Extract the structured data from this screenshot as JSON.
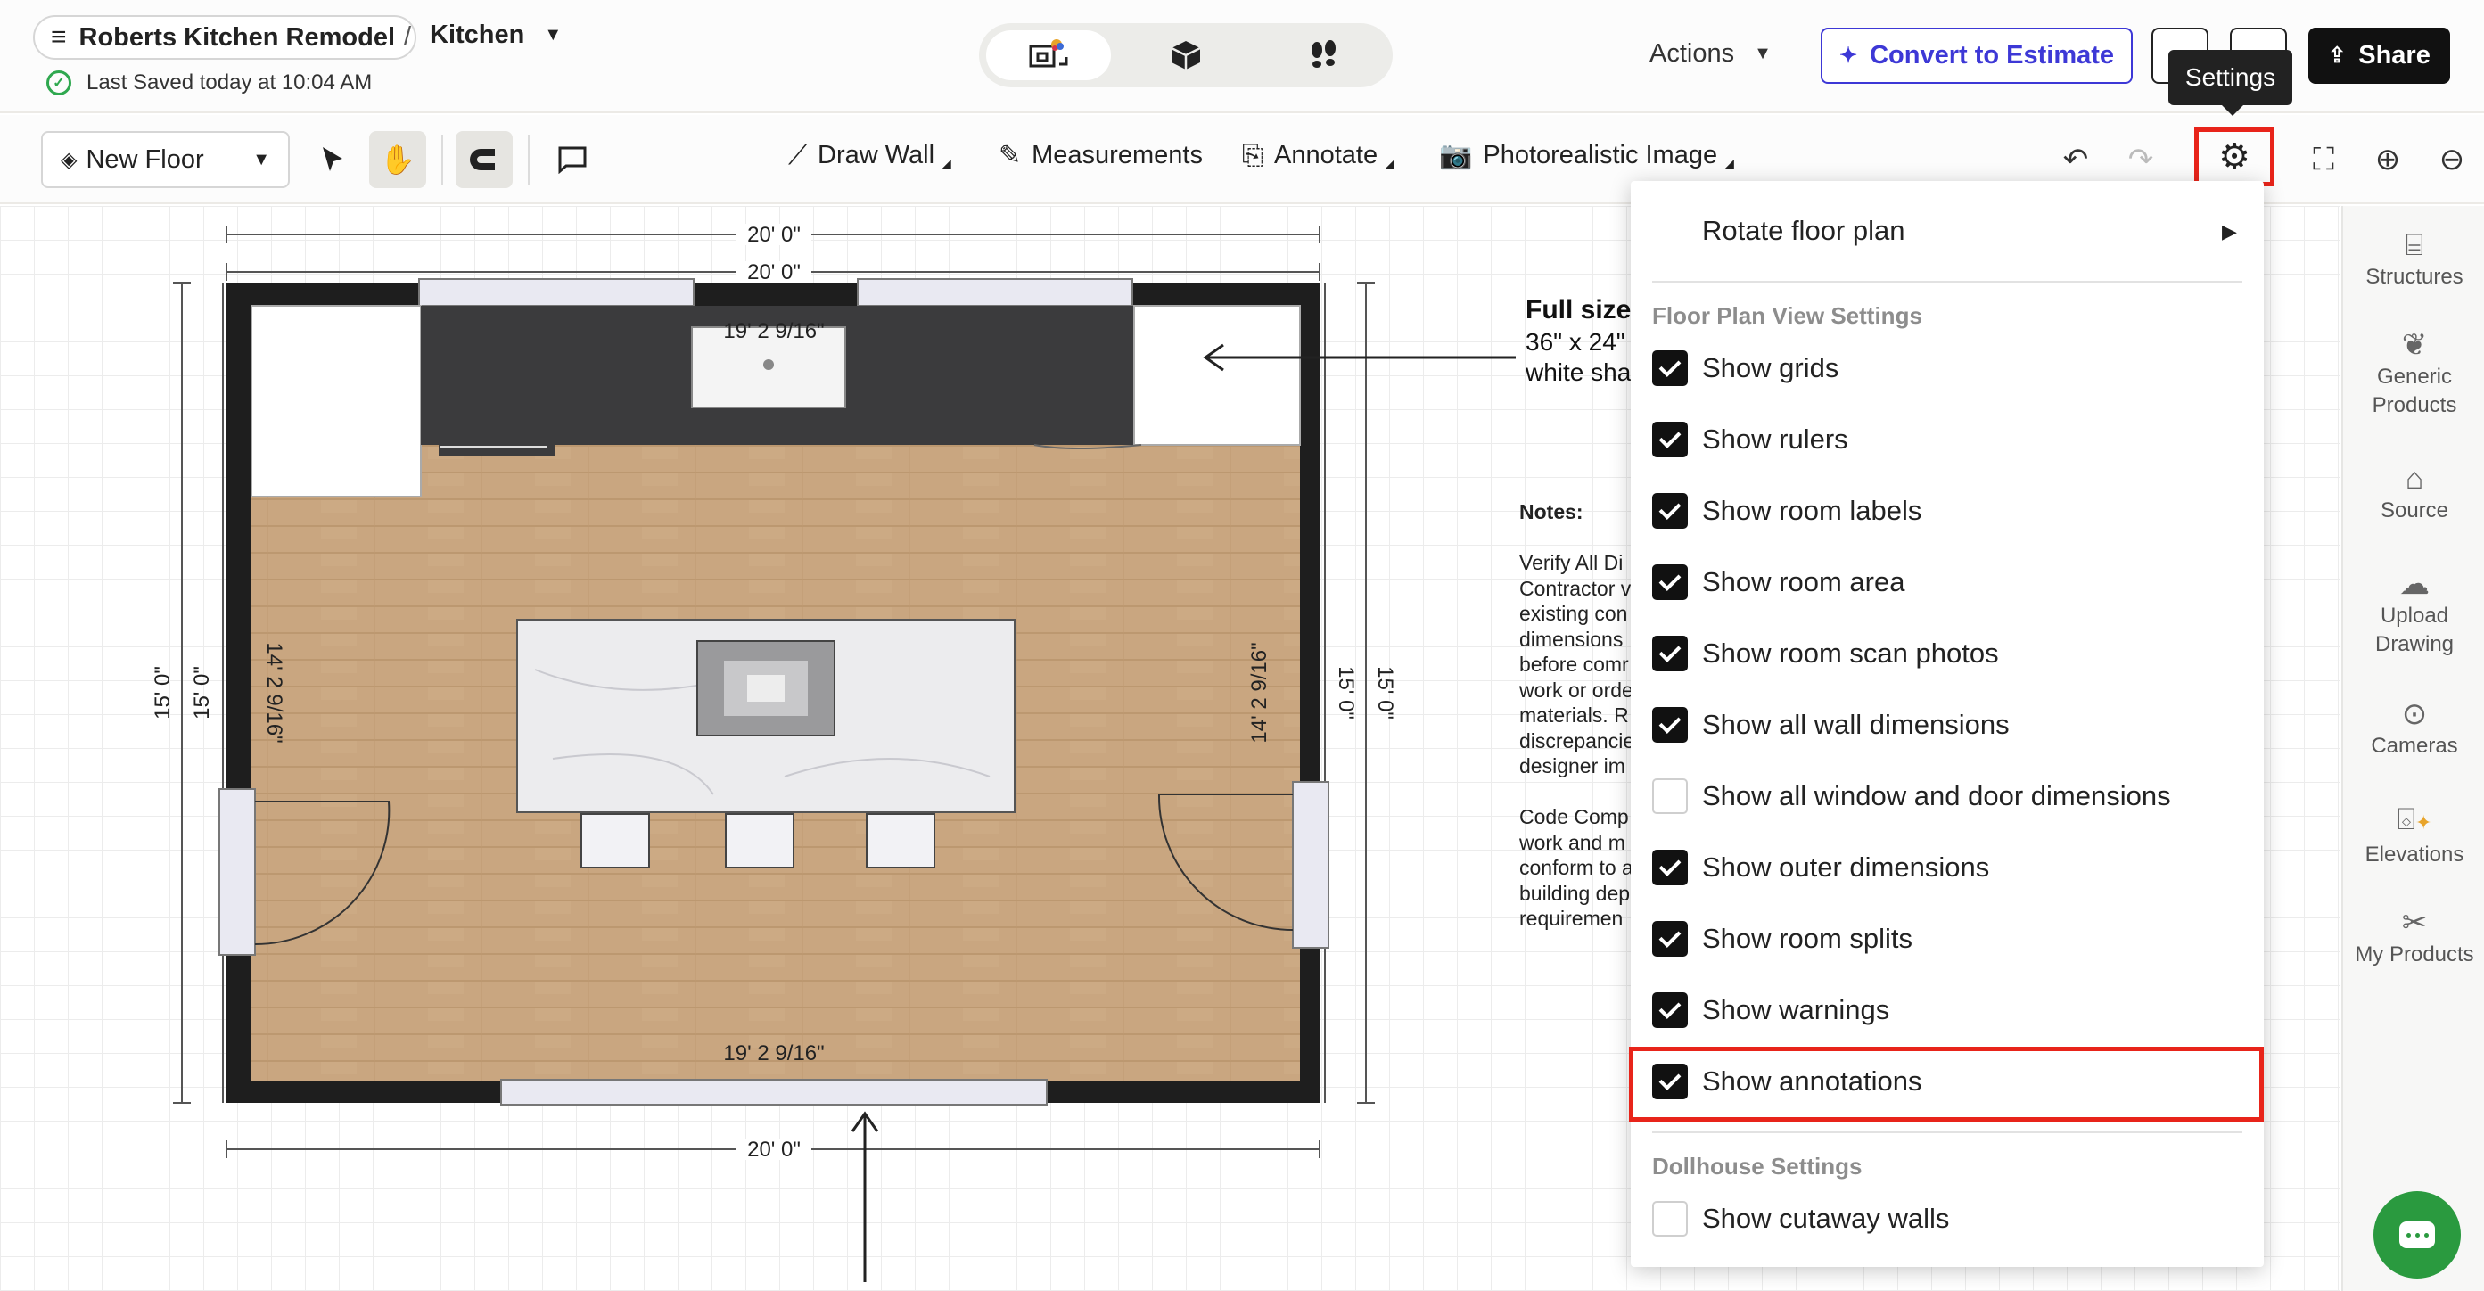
{
  "header": {
    "project_name": "Roberts Kitchen Remodel",
    "separator": "/",
    "room": "Kitchen",
    "saved_status": "Last Saved today at 10:04 AM",
    "actions_label": "Actions",
    "convert_label": "Convert to Estimate",
    "share_label": "Share"
  },
  "tooltip": "Settings",
  "toolbar": {
    "floor_label": "New Floor",
    "draw_wall": "Draw Wall",
    "measurements": "Measurements",
    "annotate": "Annotate",
    "photo_image": "Photorealistic Image"
  },
  "plan": {
    "top_outer_dim": "20' 0\"",
    "top_inner_dim": "20' 0\"",
    "bottom_outer_dim": "20' 0\"",
    "left_outer_dim": "15' 0\"",
    "left_inner_dim": "15' 0\"",
    "right_outer_dim": "15' 0\"",
    "right_inner_dim": "15' 0\"",
    "top_wall_dim": "19' 2 9/16\"",
    "bottom_wall_dim": "19' 2 9/16\"",
    "left_wall_dim": "14' 2 9/16\"",
    "right_wall_dim": "14' 2 9/16\""
  },
  "annotations": {
    "heading": "Full size",
    "line1": "36\" x 24\"",
    "line2": "white sha",
    "notes_title": "Notes:",
    "notes_body": "Verify All Di\nContractor v\nexisting con\ndimensions\nbefore comr\nwork or orde\nmaterials. R\ndiscrepancie\ndesigner im\n\nCode Comp\nwork and m\nconform to a\nbuilding dep\nrequiremen"
  },
  "settings_menu": {
    "rotate_label": "Rotate floor plan",
    "section_floor": "Floor Plan View Settings",
    "section_dollhouse": "Dollhouse Settings",
    "options": [
      {
        "label": "Show grids",
        "checked": true
      },
      {
        "label": "Show rulers",
        "checked": true
      },
      {
        "label": "Show room labels",
        "checked": true
      },
      {
        "label": "Show room area",
        "checked": true
      },
      {
        "label": "Show room scan photos",
        "checked": true
      },
      {
        "label": "Show all wall dimensions",
        "checked": true
      },
      {
        "label": "Show all window and door dimensions",
        "checked": false
      },
      {
        "label": "Show outer dimensions",
        "checked": true
      },
      {
        "label": "Show room splits",
        "checked": true
      },
      {
        "label": "Show warnings",
        "checked": true
      },
      {
        "label": "Show annotations",
        "checked": true
      }
    ],
    "dollhouse_options": [
      {
        "label": "Show cutaway walls",
        "checked": false
      }
    ]
  },
  "rail": [
    {
      "label": "Structures",
      "icon": "stairs-icon"
    },
    {
      "label": "Generic Products",
      "icon": "generic-products-icon"
    },
    {
      "label": "Source",
      "icon": "source-icon"
    },
    {
      "label": "Upload Drawing",
      "icon": "upload-cloud-icon"
    },
    {
      "label": "Cameras",
      "icon": "camera-icon"
    },
    {
      "label": "Elevations",
      "icon": "elevations-icon"
    },
    {
      "label": "My Products",
      "icon": "my-products-icon"
    }
  ],
  "colors": {
    "accent": "#3d38d6",
    "highlight": "#e8241a",
    "saved": "#2fa84f",
    "chat": "#2a9a3f",
    "floor": "#c9a680",
    "wall": "#1e1e1e",
    "counter": "#3b3b3d"
  }
}
